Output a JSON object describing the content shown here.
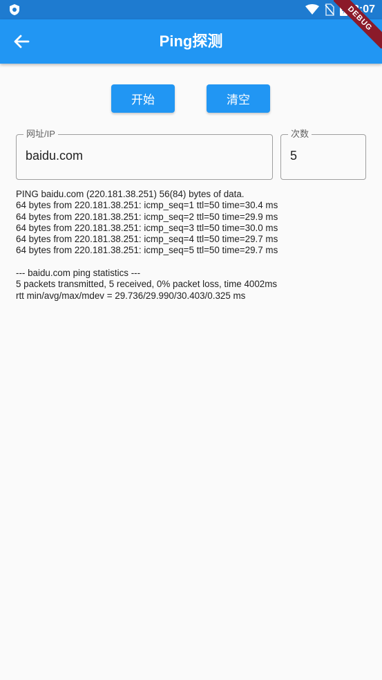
{
  "status_bar": {
    "time": "3:07",
    "left_icon": "shield-app-icon",
    "icons": [
      "wifi-icon",
      "no-sim-icon",
      "battery-charging-icon"
    ]
  },
  "app_bar": {
    "title": "Ping探测",
    "back_icon": "arrow-back-icon",
    "debug_banner": "DEBUG"
  },
  "buttons": {
    "start_label": "开始",
    "clear_label": "清空"
  },
  "fields": {
    "url": {
      "label": "网址/IP",
      "value": "baidu.com"
    },
    "count": {
      "label": "次数",
      "value": "5"
    }
  },
  "output": {
    "lines": [
      "PING baidu.com (220.181.38.251) 56(84) bytes of data.",
      "64 bytes from 220.181.38.251: icmp_seq=1 ttl=50 time=30.4 ms",
      "64 bytes from 220.181.38.251: icmp_seq=2 ttl=50 time=29.9 ms",
      "64 bytes from 220.181.38.251: icmp_seq=3 ttl=50 time=30.0 ms",
      "64 bytes from 220.181.38.251: icmp_seq=4 ttl=50 time=29.7 ms",
      "64 bytes from 220.181.38.251: icmp_seq=5 ttl=50 time=29.7 ms",
      "",
      "--- baidu.com ping statistics ---",
      "5 packets transmitted, 5 received, 0% packet loss, time 4002ms",
      "rtt min/avg/max/mdev = 29.736/29.990/30.403/0.325 ms"
    ]
  },
  "colors": {
    "primary": "#2196f3",
    "status_bar": "#1e7bd0",
    "background": "#fafafa",
    "debug_ribbon": "#8b1a2a"
  }
}
